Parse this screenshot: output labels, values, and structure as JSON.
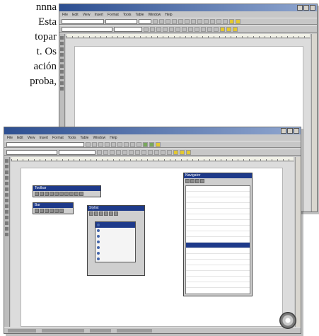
{
  "text_fragment": {
    "lines": [
      "nnna",
      "Esta",
      "topar",
      "t. Os",
      "ación",
      "proba,"
    ]
  },
  "back_window": {
    "menu": [
      "File",
      "Edit",
      "View",
      "Insert",
      "Format",
      "Tools",
      "Table",
      "Window",
      "Help"
    ]
  },
  "front_window": {
    "menu": [
      "File",
      "Edit",
      "View",
      "Insert",
      "Format",
      "Tools",
      "Table",
      "Window",
      "Help"
    ],
    "palette1_title": "Toolbar",
    "palette2_title": "Bar",
    "palette3_title": "Stylist",
    "list_title": "Navigator",
    "list_items": [
      "",
      "",
      "",
      "",
      "",
      "",
      "",
      "",
      "",
      "",
      "",
      "",
      "",
      "",
      "",
      "",
      "",
      "",
      "",
      ""
    ],
    "menu_items": [
      "",
      "",
      "",
      "",
      "",
      "",
      ""
    ]
  },
  "colors": {
    "title_active": "#1e3a8a",
    "chrome": "#c7c7c7",
    "page": "#ffffff"
  }
}
